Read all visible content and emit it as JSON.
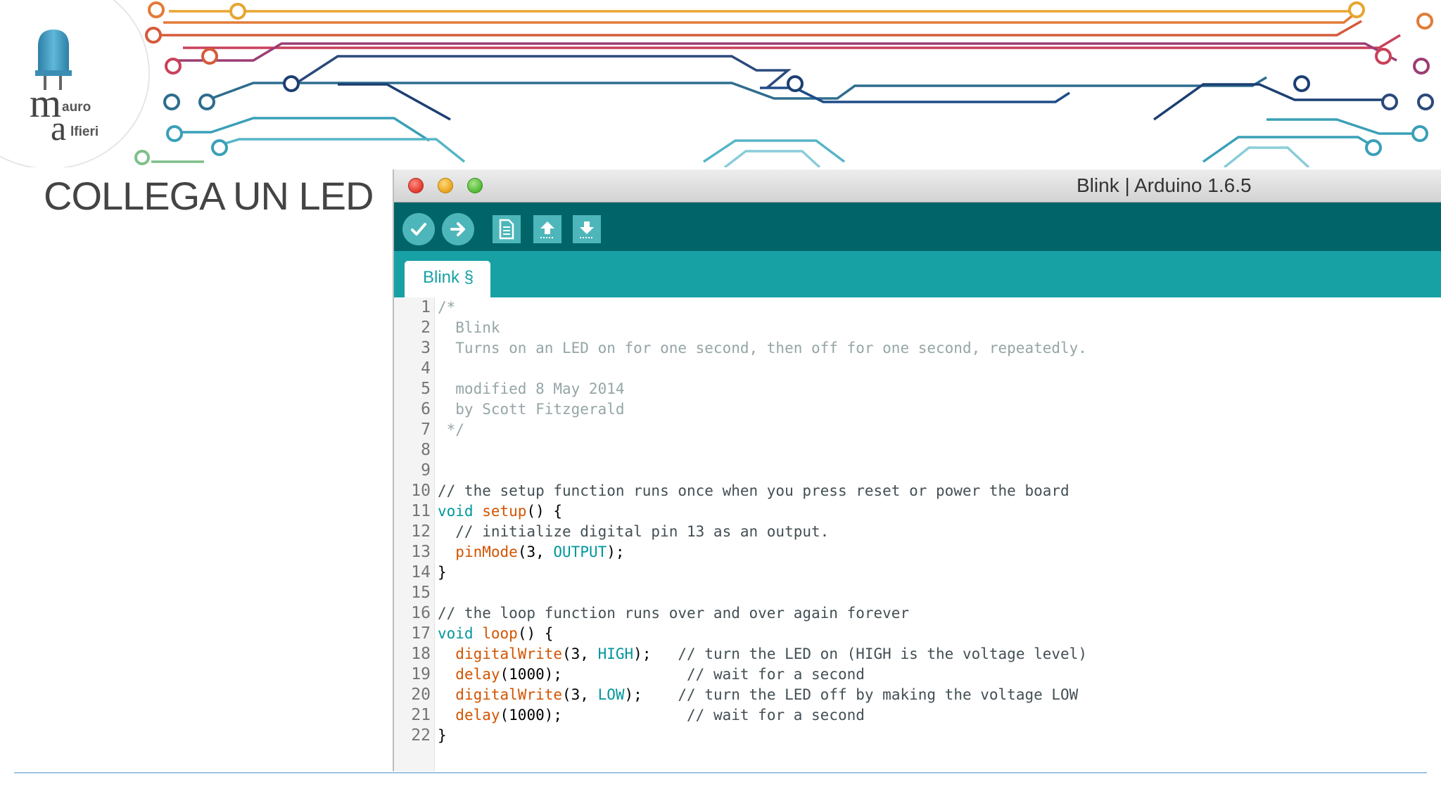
{
  "slide": {
    "title": "COLLEGA UN LED",
    "logo": {
      "m": "m",
      "m_rest": "auro",
      "a": "a",
      "a_rest": "lfieri"
    }
  },
  "window": {
    "title": "Blink | Arduino 1.6.5"
  },
  "toolbar": {
    "verify_icon": "check-icon",
    "upload_icon": "arrow-right-icon",
    "new_icon": "document-icon",
    "open_icon": "arrow-up-icon",
    "save_icon": "arrow-down-icon"
  },
  "tabs": [
    {
      "label": "Blink §"
    }
  ],
  "colors": {
    "toolbar": "#006468",
    "tabbar": "#17a1a5",
    "button": "#4db6ba",
    "keyword": "#00979c",
    "function": "#d35400",
    "comment": "#95a5a6"
  },
  "code": {
    "line_numbers": [
      "1",
      "2",
      "3",
      "4",
      "5",
      "6",
      "7",
      "8",
      "9",
      "10",
      "11",
      "12",
      "13",
      "14",
      "15",
      "16",
      "17",
      "18",
      "19",
      "20",
      "21",
      "22"
    ],
    "l1": "/*",
    "l2": "  Blink",
    "l3": "  Turns on an LED on for one second, then off for one second, repeatedly.",
    "l4": "",
    "l5": "  modified 8 May 2014",
    "l6": "  by Scott Fitzgerald",
    "l7": " */",
    "l8": "",
    "l9": "",
    "l10": "// the setup function runs once when you press reset or power the board",
    "l11_kw": "void",
    "l11_fn": "setup",
    "l11_rest": "() {",
    "l12": "  // initialize digital pin 13 as an output.",
    "l13_fn": "pinMode",
    "l13_a": "(3, ",
    "l13_const": "OUTPUT",
    "l13_b": ");",
    "l14": "}",
    "l15": "",
    "l16": "// the loop function runs over and over again forever",
    "l17_kw": "void",
    "l17_fn": "loop",
    "l17_rest": "() {",
    "l18_fn": "digitalWrite",
    "l18_a": "(3, ",
    "l18_const": "HIGH",
    "l18_b": ");   ",
    "l18_cmt": "// turn the LED on (HIGH is the voltage level)",
    "l19_fn": "delay",
    "l19_a": "(1000);              ",
    "l19_cmt": "// wait for a second",
    "l20_fn": "digitalWrite",
    "l20_a": "(3, ",
    "l20_const": "LOW",
    "l20_b": ");    ",
    "l20_cmt": "// turn the LED off by making the voltage LOW",
    "l21_fn": "delay",
    "l21_a": "(1000);              ",
    "l21_cmt": "// wait for a second",
    "l22": "}"
  }
}
